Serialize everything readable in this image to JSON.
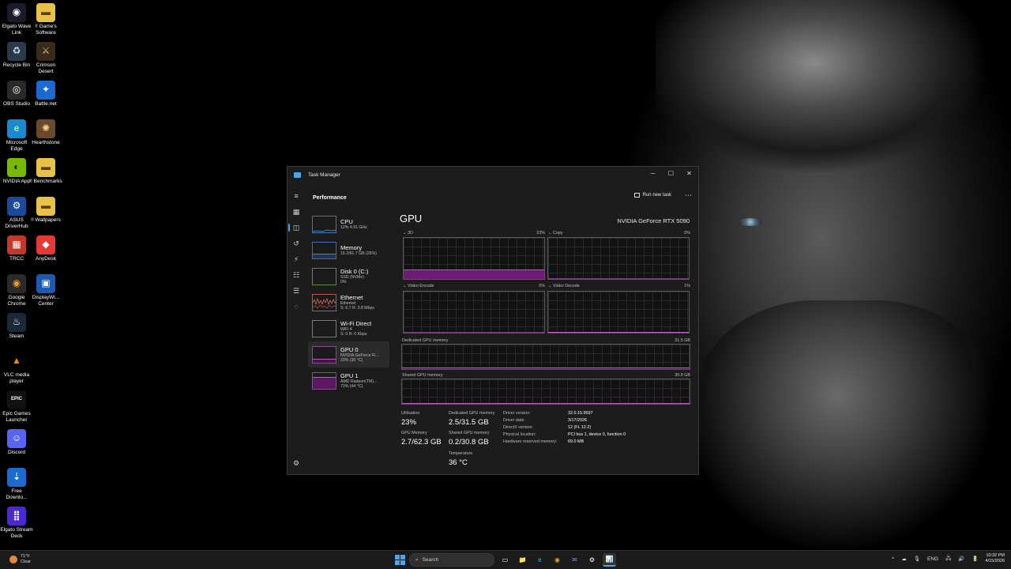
{
  "desktop": {
    "icons": [
      {
        "label": "Elgato Wave Link",
        "glyph": "◉",
        "color": "#1a1a2a",
        "fg": "#fff"
      },
      {
        "label": "!! Game's Software",
        "glyph": "▬",
        "color": "#e8c04a",
        "fg": "#5a4200"
      },
      {
        "label": "Recycle Bin",
        "glyph": "♻",
        "color": "#2a3a4a",
        "fg": "#cfe0f0"
      },
      {
        "label": "Crimson Desert",
        "glyph": "⚔",
        "color": "#3a2a1a",
        "fg": "#d8c090"
      },
      {
        "label": "OBS Studio",
        "glyph": "◎",
        "color": "#2a2a2a",
        "fg": "#fff"
      },
      {
        "label": "Battle.net",
        "glyph": "✦",
        "color": "#1a6ad0",
        "fg": "#fff"
      },
      {
        "label": "Microsoft Edge",
        "glyph": "e",
        "color": "#1a8ad0",
        "fg": "#9ef0a0"
      },
      {
        "label": "Hearthstone",
        "glyph": "✺",
        "color": "#6a4a2a",
        "fg": "#f0d090"
      },
      {
        "label": "NVIDIA App",
        "glyph": "◐",
        "color": "#76b900",
        "fg": "#000"
      },
      {
        "label": "!! Benchmarks",
        "glyph": "▬",
        "color": "#e8c04a",
        "fg": "#5a4200"
      },
      {
        "label": "ASUS DriverHub",
        "glyph": "⚙",
        "color": "#1a4a9a",
        "fg": "#fff"
      },
      {
        "label": "!! Wallpapers",
        "glyph": "▬",
        "color": "#e8c04a",
        "fg": "#5a4200"
      },
      {
        "label": "TRCC",
        "glyph": "▦",
        "color": "#c0392b",
        "fg": "#fff"
      },
      {
        "label": "AnyDesk",
        "glyph": "◆",
        "color": "#e53935",
        "fg": "#fff"
      },
      {
        "label": "Google Chrome",
        "glyph": "◉",
        "color": "#2a2a2a",
        "fg": "#e8a030"
      },
      {
        "label": "DisplayWi... Center",
        "glyph": "▣",
        "color": "#1a5ab0",
        "fg": "#fff"
      },
      {
        "label": "Steam",
        "glyph": "♨",
        "color": "#1b2838",
        "fg": "#fff"
      },
      {
        "label": "VLC media player",
        "glyph": "▲",
        "color": "#000",
        "fg": "#f08a00"
      },
      {
        "label": "Epic Games Launcher",
        "glyph": "EPIC",
        "color": "#111",
        "fg": "#fff"
      },
      {
        "label": "Discord",
        "glyph": "☺",
        "color": "#5865f2",
        "fg": "#fff"
      },
      {
        "label": "Free Downlo...",
        "glyph": "⇣",
        "color": "#1a6ad0",
        "fg": "#fff"
      },
      {
        "label": "Elgato Stream Deck",
        "glyph": "⣿",
        "color": "#4a2ad0",
        "fg": "#fff"
      }
    ]
  },
  "task_manager": {
    "title": "Task Manager",
    "controls": {
      "minimize": "─",
      "maximize": "☐",
      "close": "✕"
    },
    "page": "Performance",
    "run_new_task": "Run new task",
    "more": "⋯",
    "nav_icons": [
      "≡",
      "▦",
      "◫",
      "↺",
      "⚡",
      "☷",
      "☰",
      "◌"
    ],
    "settings_icon": "⚙",
    "devices": [
      {
        "name": "CPU",
        "sub1": "12% 4.91 GHz",
        "sub2": ""
      },
      {
        "name": "Memory",
        "sub1": "16.2/61.7 GB (26%)",
        "sub2": ""
      },
      {
        "name": "Disk 0 (C:)",
        "sub1": "SSD (NVMe)",
        "sub2": "0%"
      },
      {
        "name": "Ethernet",
        "sub1": "Ethernet",
        "sub2": "S: 6.7 R: 3.8 Mbps"
      },
      {
        "name": "Wi-Fi Direct",
        "sub1": "WiFi 4",
        "sub2": "S: 0 R: 0 Kbps"
      },
      {
        "name": "GPU 0",
        "sub1": "NVIDIA GeForce R...",
        "sub2": "23% (36 °C)"
      },
      {
        "name": "GPU 1",
        "sub1": "AMD Radeon(TM)...",
        "sub2": "72% (44 °C)"
      }
    ],
    "gpu": {
      "title": "GPU",
      "model": "NVIDIA GeForce RTX 5090",
      "engines": [
        {
          "name": "3D",
          "pct": "23%"
        },
        {
          "name": "Copy",
          "pct": "0%"
        },
        {
          "name": "Video Encode",
          "pct": "0%"
        },
        {
          "name": "Video Decode",
          "pct": "1%"
        }
      ],
      "engine_levels": {
        "3d": 0.23,
        "copy": 0.0,
        "video_encode": 0.0,
        "video_decode": 0.01
      },
      "dedicated_label": "Dedicated GPU memory",
      "dedicated_max": "31.5 GB",
      "shared_label": "Shared GPU memory",
      "shared_max": "30.8 GB",
      "dedicated_level": 0.08,
      "shared_level": 0.01,
      "stats": {
        "utilisation_label": "Utilisation",
        "utilisation": "23%",
        "dedicated_label": "Dedicated GPU memory",
        "dedicated": "2.5/31.5 GB",
        "gpu_memory_label": "GPU Memory",
        "gpu_memory": "2.7/62.3 GB",
        "shared_label": "Shared GPU memory",
        "shared": "0.2/30.8 GB",
        "temperature_label": "Temperature",
        "temperature": "36 °C"
      },
      "info": [
        {
          "label": "Driver version:",
          "value": "32.0.15.9597"
        },
        {
          "label": "Driver date:",
          "value": "3/17/2026"
        },
        {
          "label": "DirectX version:",
          "value": "12 (FL 12.2)"
        },
        {
          "label": "Physical location:",
          "value": "PCI bus 1, device 0, function 0"
        },
        {
          "label": "Hardware reserved memory:",
          "value": "69.0 MB"
        }
      ]
    }
  },
  "taskbar": {
    "weather_temp": "71°F",
    "weather_desc": "Clear",
    "search_placeholder": "Search",
    "apps": [
      "🗂",
      "▭",
      "📁",
      "e",
      "◉",
      "✉",
      "⚙",
      "📊"
    ],
    "tray_icons": [
      "^",
      "☁",
      "🎙",
      "ENG",
      "🖧",
      "🔊",
      "🔋"
    ],
    "language": "ENG",
    "time": "10:32 PM",
    "date": "4/15/2026"
  },
  "colors": {
    "accent": "#4ea4e8",
    "gpu_graph": "#b85cc0",
    "gpu_fill": "#6c1a73"
  }
}
